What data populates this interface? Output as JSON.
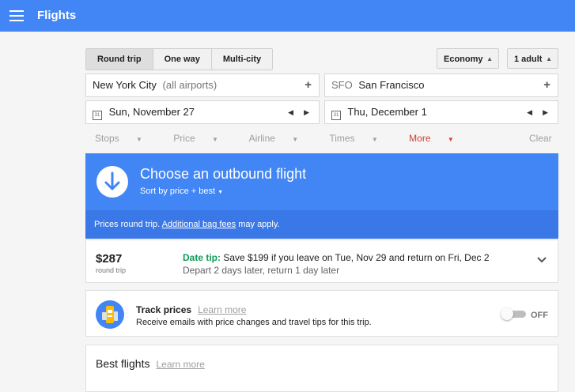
{
  "app": {
    "title": "Flights"
  },
  "trip_types": [
    "Round trip",
    "One way",
    "Multi-city"
  ],
  "cabin": {
    "value": "Economy"
  },
  "passengers": {
    "value": "1 adult"
  },
  "origin": {
    "name": "New York City",
    "suffix": "(all airports)"
  },
  "destination": {
    "code": "SFO",
    "name": "San Francisco"
  },
  "depart_date": "Sun, November 27",
  "return_date": "Thu, December 1",
  "calendar_icon_text": "31",
  "filters": {
    "stops": "Stops",
    "price": "Price",
    "airline": "Airline",
    "times": "Times",
    "more": "More",
    "clear": "Clear"
  },
  "banner": {
    "title": "Choose an outbound flight",
    "sort": "Sort by price + best"
  },
  "notice": {
    "prefix": "Prices round trip. ",
    "link": "Additional bag fees",
    "suffix": " may apply."
  },
  "date_tip": {
    "price": "$287",
    "price_sub": "round trip",
    "label": "Date tip:",
    "text": " Save $199 if you leave on Tue, Nov 29 and return on Fri, Dec 2",
    "sub": "Depart 2 days later, return 1 day later"
  },
  "track": {
    "title": "Track prices",
    "learn_more": "Learn more",
    "desc": "Receive emails with price changes and travel tips for this trip.",
    "toggle_state": "OFF"
  },
  "best": {
    "title": "Best flights",
    "learn_more": "Learn more"
  },
  "colors": {
    "primary": "#4285f4",
    "primary_dark": "#3b78e7",
    "tip_green": "#0f9d58",
    "more_red": "#d23f31"
  },
  "icons": [
    "menu-icon",
    "plus-icon",
    "calendar-icon",
    "chevron-left-icon",
    "chevron-right-icon",
    "caret-down-icon",
    "arrow-down-icon",
    "chevron-down-icon",
    "price-tracking-icon"
  ]
}
